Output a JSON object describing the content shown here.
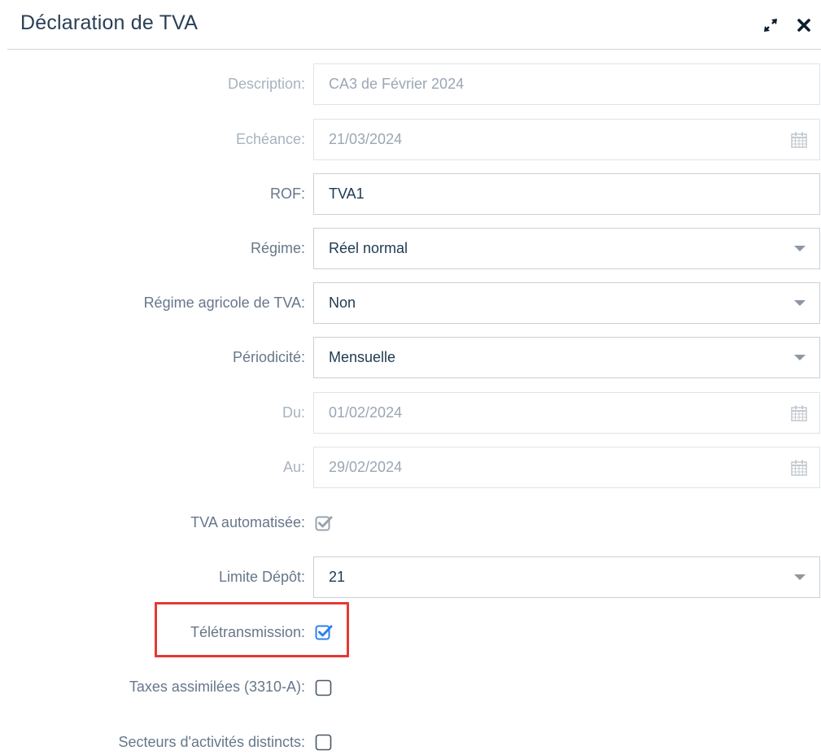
{
  "header": {
    "title": "Déclaration de TVA"
  },
  "form": {
    "description": {
      "label": "Description:",
      "value": "CA3 de Février 2024"
    },
    "echeance": {
      "label": "Echéance:",
      "value": "21/03/2024"
    },
    "rof": {
      "label": "ROF:",
      "value": "TVA1"
    },
    "regime": {
      "label": "Régime:",
      "value": "Réel normal"
    },
    "regime_agricole": {
      "label": "Régime agricole de TVA:",
      "value": "Non"
    },
    "periodicite": {
      "label": "Périodicité:",
      "value": "Mensuelle"
    },
    "du": {
      "label": "Du:",
      "value": "01/02/2024"
    },
    "au": {
      "label": "Au:",
      "value": "29/02/2024"
    },
    "tva_auto": {
      "label": "TVA automatisée:",
      "checked": true,
      "disabled": true
    },
    "limite_depot": {
      "label": "Limite Dépôt:",
      "value": "21"
    },
    "teletransmission": {
      "label": "Télétransmission:",
      "checked": true
    },
    "taxes_assimilees": {
      "label": "Taxes assimilées (3310-A):",
      "checked": false
    },
    "secteurs": {
      "label": "Secteurs d'activités distincts:",
      "checked": false
    }
  },
  "icons": {
    "expand": "expand-arrows-icon",
    "close": "close-x-icon",
    "calendar": "calendar-icon",
    "dropdown": "caret-down-icon"
  },
  "colors": {
    "highlight_border": "#e53935",
    "checkbox_active": "#2f80ed",
    "checkbox_disabled": "#9aa4ad"
  }
}
